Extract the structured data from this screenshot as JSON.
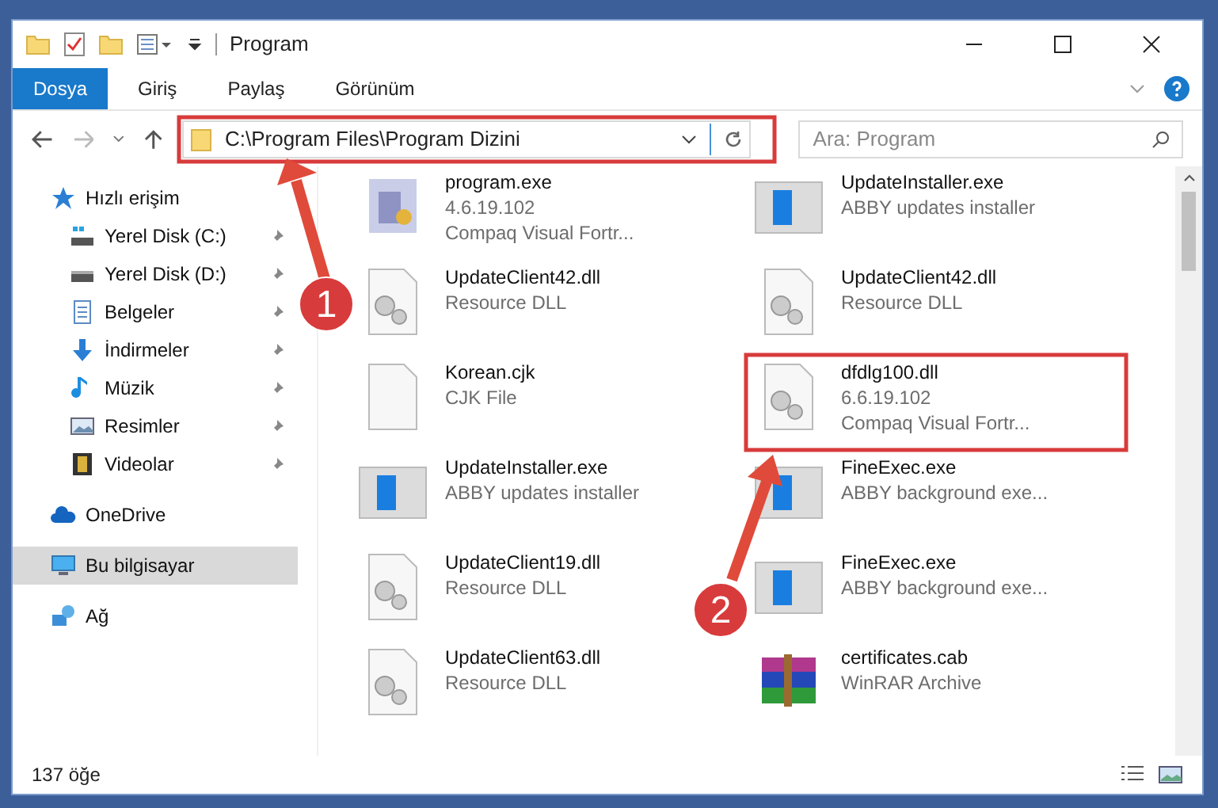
{
  "window": {
    "title": "Program"
  },
  "ribbon_tabs": [
    {
      "label": "Dosya",
      "selected": true
    },
    {
      "label": "Giriş",
      "selected": false
    },
    {
      "label": "Paylaş",
      "selected": false
    },
    {
      "label": "Görünüm",
      "selected": false
    }
  ],
  "address": {
    "value": "C:\\Program Files\\Program Dizini"
  },
  "search": {
    "placeholder": "Ara: Program"
  },
  "sidebar": {
    "items": [
      {
        "label": "Hızlı erişim",
        "kind": "star",
        "pinned": false,
        "selected": false,
        "children": [
          {
            "label": "Yerel Disk (C:)",
            "kind": "drive-c",
            "pinned": true,
            "selected": false
          },
          {
            "label": "Yerel Disk (D:)",
            "kind": "drive",
            "pinned": true,
            "selected": false
          },
          {
            "label": "Belgeler",
            "kind": "docs",
            "pinned": true,
            "selected": false
          },
          {
            "label": "İndirmeler",
            "kind": "download",
            "pinned": true,
            "selected": false
          },
          {
            "label": "Müzik",
            "kind": "music",
            "pinned": true,
            "selected": false
          },
          {
            "label": "Resimler",
            "kind": "pictures",
            "pinned": true,
            "selected": false
          },
          {
            "label": "Videolar",
            "kind": "video",
            "pinned": true,
            "selected": false
          }
        ]
      },
      {
        "label": "OneDrive",
        "kind": "cloud",
        "pinned": false,
        "selected": false
      },
      {
        "label": "Bu bilgisayar",
        "kind": "pc",
        "pinned": false,
        "selected": true
      },
      {
        "label": "Ağ",
        "kind": "network",
        "pinned": false,
        "selected": false
      }
    ]
  },
  "files": [
    {
      "name": "program.exe",
      "lines": [
        "4.6.19.102",
        "Compaq Visual Fortr..."
      ],
      "kind": "app"
    },
    {
      "name": "UpdateInstaller.exe",
      "lines": [
        "ABBY updates installer"
      ],
      "kind": "window"
    },
    {
      "name": "UpdateClient42.dll",
      "lines": [
        "Resource DLL"
      ],
      "kind": "dll"
    },
    {
      "name": "UpdateClient42.dll",
      "lines": [
        "Resource DLL"
      ],
      "kind": "dll"
    },
    {
      "name": "Korean.cjk",
      "lines": [
        "CJK File"
      ],
      "kind": "blank"
    },
    {
      "name": "dfdlg100.dll",
      "lines": [
        "6.6.19.102",
        "Compaq Visual Fortr..."
      ],
      "kind": "dll"
    },
    {
      "name": "UpdateInstaller.exe",
      "lines": [
        "ABBY updates installer"
      ],
      "kind": "window"
    },
    {
      "name": "FineExec.exe",
      "lines": [
        "ABBY background exe..."
      ],
      "kind": "window"
    },
    {
      "name": "UpdateClient19.dll",
      "lines": [
        "Resource DLL"
      ],
      "kind": "dll"
    },
    {
      "name": "FineExec.exe",
      "lines": [
        "ABBY background exe..."
      ],
      "kind": "window"
    },
    {
      "name": "UpdateClient63.dll",
      "lines": [
        "Resource DLL"
      ],
      "kind": "dll"
    },
    {
      "name": "certificates.cab",
      "lines": [
        "WinRAR Archive"
      ],
      "kind": "archive"
    }
  ],
  "status_bar": {
    "count": "137 öğe"
  },
  "annotations": [
    {
      "number": "1"
    },
    {
      "number": "2"
    }
  ]
}
